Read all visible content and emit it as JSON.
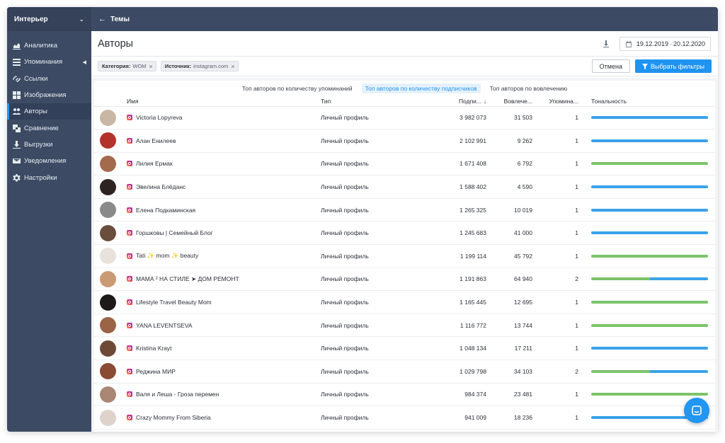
{
  "sidebar": {
    "header": "Интерьер",
    "items": [
      {
        "label": "Аналитика",
        "icon": "chart-icon"
      },
      {
        "label": "Упоминания",
        "icon": "mentions-icon"
      },
      {
        "label": "Ссылки",
        "icon": "link-icon"
      },
      {
        "label": "Изображения",
        "icon": "images-icon"
      },
      {
        "label": "Авторы",
        "icon": "users-icon"
      },
      {
        "label": "Сравнение",
        "icon": "compare-icon"
      },
      {
        "label": "Выгрузки",
        "icon": "download-icon"
      },
      {
        "label": "Уведомления",
        "icon": "mail-icon"
      },
      {
        "label": "Настройки",
        "icon": "gear-icon"
      }
    ],
    "active_index": 4
  },
  "topbar": {
    "back_label": "Темы"
  },
  "header": {
    "title": "Авторы",
    "date_from": "19.12.2019",
    "date_to": "20.12.2020"
  },
  "filters": {
    "chips": [
      {
        "key": "Категория:",
        "value": "WOM"
      },
      {
        "key": "Источник:",
        "value": "instagram.com"
      }
    ],
    "cancel_label": "Отмена",
    "apply_label": "Выбрать фильтры"
  },
  "tabs": [
    {
      "label": "Топ авторов по количеству упоминаний",
      "active": false
    },
    {
      "label": "Топ авторов по количеству подписчиков",
      "active": true
    },
    {
      "label": "Топ авторов по вовлечению",
      "active": false
    }
  ],
  "table": {
    "columns": {
      "name": "Имя",
      "type": "Тип",
      "subscribers": "Подпи...",
      "engagement": "Вовлече...",
      "mentions": "Упомина...",
      "tone": "Тональность"
    },
    "rows": [
      {
        "name": "Victoria Lopyreva",
        "type": "Личный профиль",
        "subscribers": "3 982 073",
        "engagement": "31 503",
        "mentions": "1",
        "positive": 0,
        "avatar": "#c9b7a6"
      },
      {
        "name": "Алан Енилеев",
        "type": "Личный профиль",
        "subscribers": "2 102 991",
        "engagement": "9 262",
        "mentions": "1",
        "positive": 0,
        "avatar": "#b3322a"
      },
      {
        "name": "Лилия Ермак",
        "type": "Личный профиль",
        "subscribers": "1 671 408",
        "engagement": "6 792",
        "mentions": "1",
        "positive": 1,
        "avatar": "#a36a4d"
      },
      {
        "name": "Эвелина Блёданс",
        "type": "Личный профиль",
        "subscribers": "1 588 402",
        "engagement": "4 590",
        "mentions": "1",
        "positive": 0,
        "avatar": "#2d2421"
      },
      {
        "name": "Елена Подкаминская",
        "type": "Личный профиль",
        "subscribers": "1 265 325",
        "engagement": "10 019",
        "mentions": "1",
        "positive": 0,
        "avatar": "#8a8a8a"
      },
      {
        "name": "Горшковы | Семейный Блог",
        "type": "Личный профиль",
        "subscribers": "1 245 683",
        "engagement": "41 000",
        "mentions": "1",
        "positive": 0,
        "avatar": "#6b4d3d"
      },
      {
        "name": "Tati ✨ mom ✨ beauty",
        "type": "Личный профиль",
        "subscribers": "1 199 114",
        "engagement": "45 792",
        "mentions": "1",
        "positive": 1,
        "avatar": "#e9e2dc"
      },
      {
        "name": "МАМА ² НА СТИЛЕ ➤ ДОМ РЕМОНТ",
        "type": "Личный профиль",
        "subscribers": "1 191 863",
        "engagement": "64 940",
        "mentions": "2",
        "positive": 0.5,
        "avatar": "#c99a74"
      },
      {
        "name": "Lifestyle Travel Beauty Mom",
        "type": "Личный профиль",
        "subscribers": "1 165 445",
        "engagement": "12 695",
        "mentions": "1",
        "positive": 1,
        "avatar": "#1e1a19"
      },
      {
        "name": "YANA LEVENTSEVA",
        "type": "Личный профиль",
        "subscribers": "1 116 772",
        "engagement": "13 744",
        "mentions": "1",
        "positive": 1,
        "avatar": "#9c6447"
      },
      {
        "name": "Kristina Krayt",
        "type": "Личный профиль",
        "subscribers": "1 048 134",
        "engagement": "17 211",
        "mentions": "1",
        "positive": 0,
        "avatar": "#6e4a36"
      },
      {
        "name": "Реджина МИР",
        "type": "Личный профиль",
        "subscribers": "1 029 798",
        "engagement": "34 103",
        "mentions": "2",
        "positive": 0.5,
        "avatar": "#8b4a33"
      },
      {
        "name": "Валя и Леша - Гроза перемен",
        "type": "Личный профиль",
        "subscribers": "984 374",
        "engagement": "23 481",
        "mentions": "1",
        "positive": 1,
        "avatar": "#a98774"
      },
      {
        "name": "Crazy Mommy From Siberia",
        "type": "Личный профиль",
        "subscribers": "941 009",
        "engagement": "18 236",
        "mentions": "1",
        "positive": 0,
        "avatar": "#ddd3cc"
      }
    ]
  },
  "colors": {
    "sidebar": "#3c4b63",
    "accent": "#1f93f0",
    "positive": "#7cc36a",
    "neutral": "#3aa2ea"
  }
}
